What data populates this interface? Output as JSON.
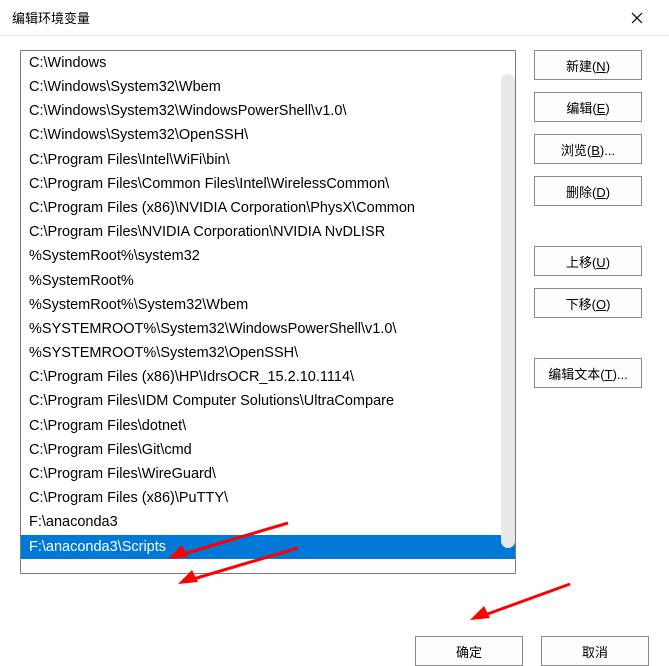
{
  "title": "编辑环境变量",
  "list_items": [
    "C:\\Windows",
    "C:\\Windows\\System32\\Wbem",
    "C:\\Windows\\System32\\WindowsPowerShell\\v1.0\\",
    "C:\\Windows\\System32\\OpenSSH\\",
    "C:\\Program Files\\Intel\\WiFi\\bin\\",
    "C:\\Program Files\\Common Files\\Intel\\WirelessCommon\\",
    "C:\\Program Files (x86)\\NVIDIA Corporation\\PhysX\\Common",
    "C:\\Program Files\\NVIDIA Corporation\\NVIDIA NvDLISR",
    "%SystemRoot%\\system32",
    "%SystemRoot%",
    "%SystemRoot%\\System32\\Wbem",
    "%SYSTEMROOT%\\System32\\WindowsPowerShell\\v1.0\\",
    "%SYSTEMROOT%\\System32\\OpenSSH\\",
    "C:\\Program Files (x86)\\HP\\IdrsOCR_15.2.10.1114\\",
    "C:\\Program Files\\IDM Computer Solutions\\UltraCompare",
    "C:\\Program Files\\dotnet\\",
    "C:\\Program Files\\Git\\cmd",
    "C:\\Program Files\\WireGuard\\",
    "C:\\Program Files (x86)\\PuTTY\\",
    "F:\\anaconda3",
    "F:\\anaconda3\\Scripts"
  ],
  "selected_index": 20,
  "buttons": {
    "new": "新建(N)",
    "edit": "编辑(E)",
    "browse": "浏览(B)...",
    "delete": "删除(D)",
    "move_up": "上移(U)",
    "move_down": "下移(O)",
    "edit_text": "编辑文本(T)...",
    "ok": "确定",
    "cancel": "取消"
  }
}
